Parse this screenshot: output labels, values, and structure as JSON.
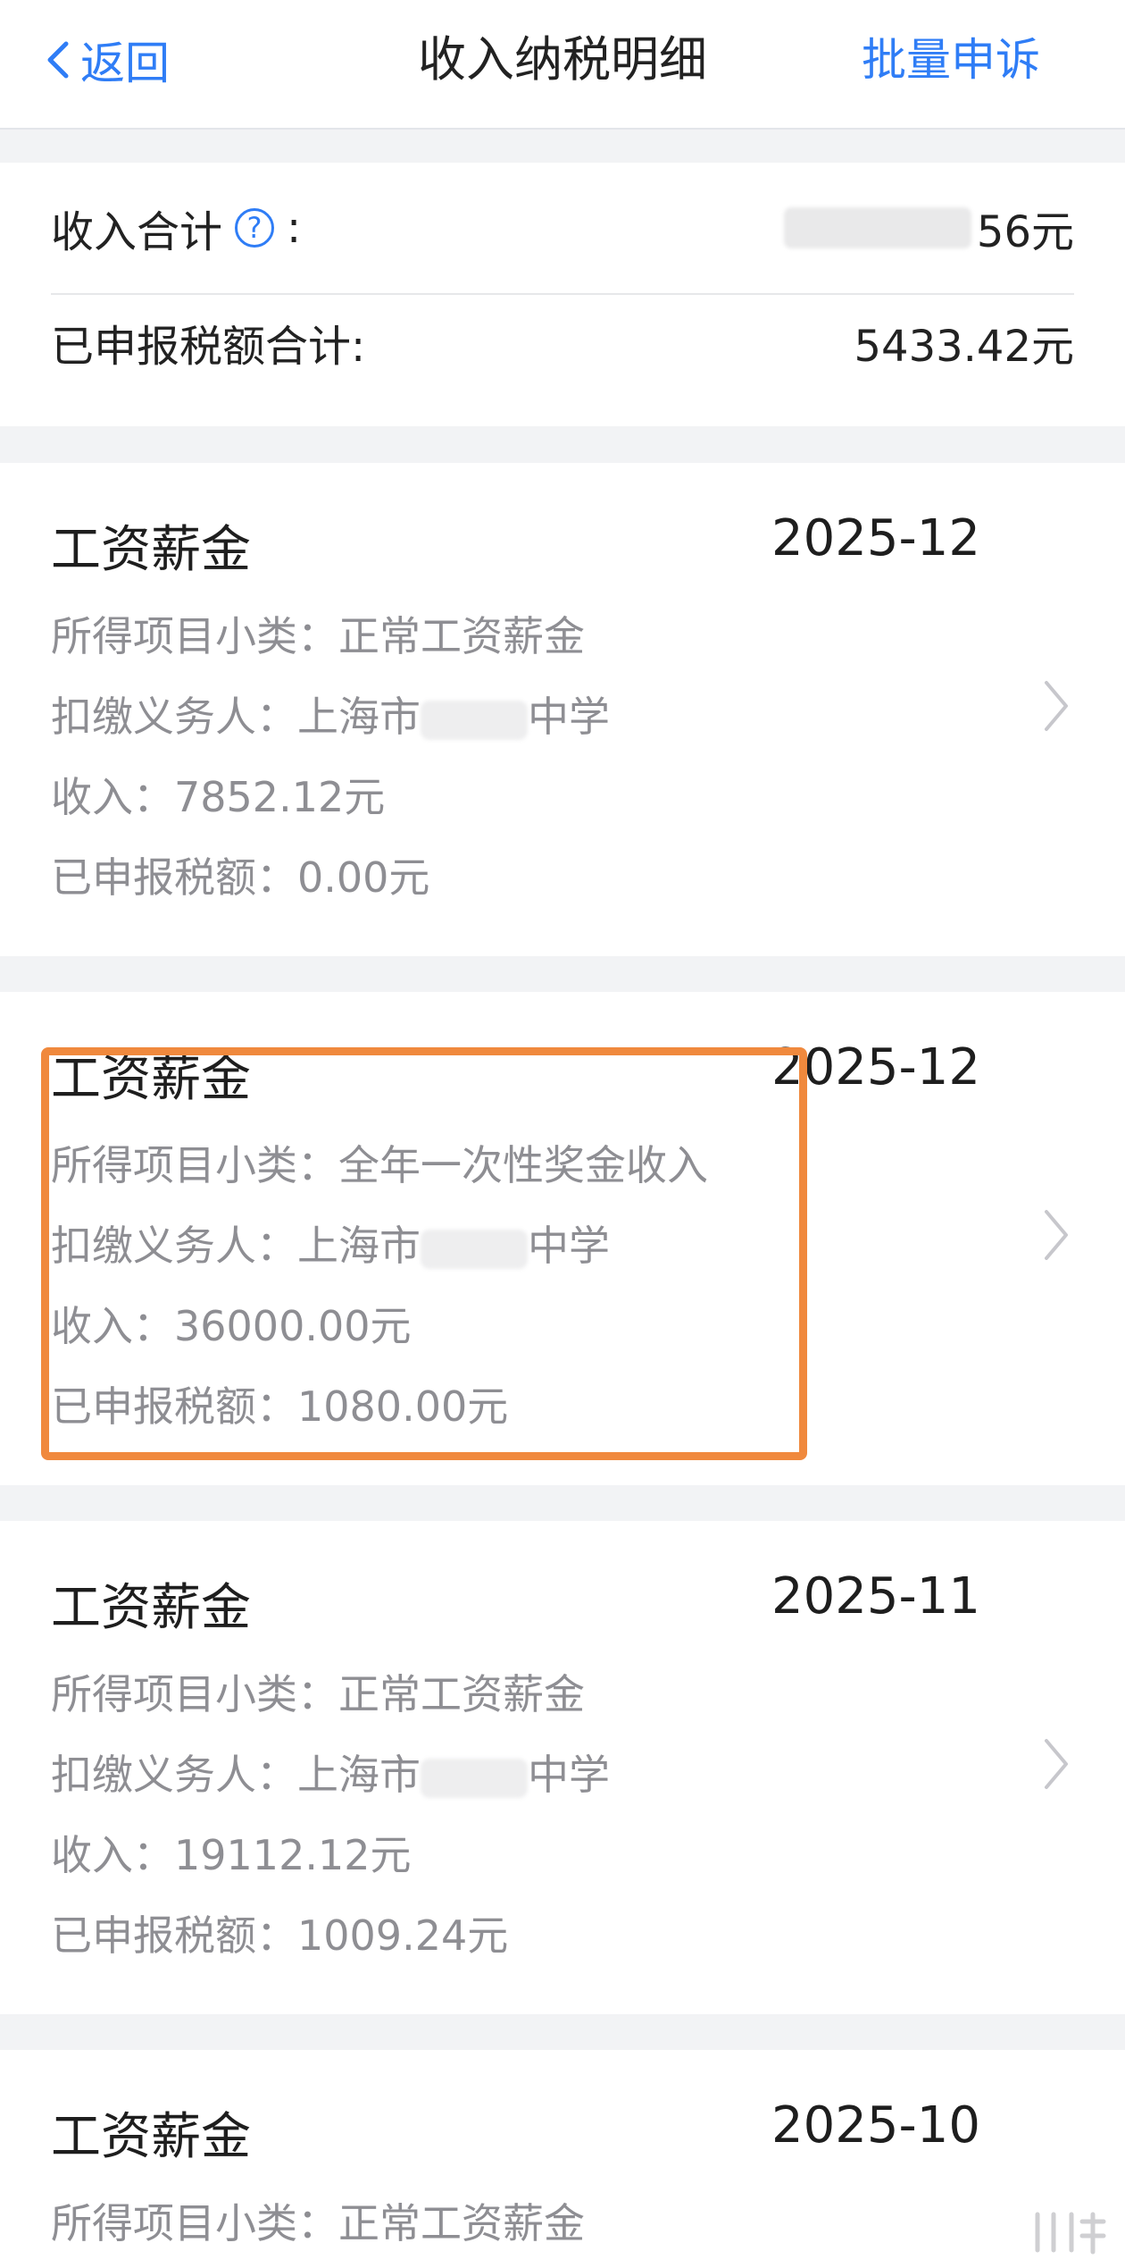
{
  "nav": {
    "back_label": "返回",
    "title": "收入纳税明细",
    "action_label": "批量申诉"
  },
  "summary": {
    "income_total_label": "收入合计",
    "income_total_colon": ":",
    "income_total_value_visible": "56元",
    "tax_total_label": "已申报税额合计:",
    "tax_total_value": "5433.42元"
  },
  "records": [
    {
      "title": "工资薪金",
      "date": "2025-12",
      "subcategory_line": "所得项目小类：正常工资薪金",
      "withholder_prefix": "扣缴义务人：上海市",
      "withholder_suffix": "中学",
      "income_line": "收入：7852.12元",
      "tax_line": "已申报税额：0.00元"
    },
    {
      "title": "工资薪金",
      "date": "2025-12",
      "subcategory_line": "所得项目小类：全年一次性奖金收入",
      "withholder_prefix": "扣缴义务人：上海市",
      "withholder_suffix": "中学",
      "income_line": "收入：36000.00元",
      "tax_line": "已申报税额：1080.00元"
    },
    {
      "title": "工资薪金",
      "date": "2025-11",
      "subcategory_line": "所得项目小类：正常工资薪金",
      "withholder_prefix": "扣缴义务人：上海市",
      "withholder_suffix": "中学",
      "income_line": "收入：19112.12元",
      "tax_line": "已申报税额：1009.24元"
    },
    {
      "title": "工资薪金",
      "date": "2025-10",
      "subcategory_line": "所得项目小类：正常工资薪金"
    }
  ],
  "colors": {
    "accent": "#2f7df6",
    "highlight": "#f0893d",
    "muted_text": "#8e8e93"
  }
}
